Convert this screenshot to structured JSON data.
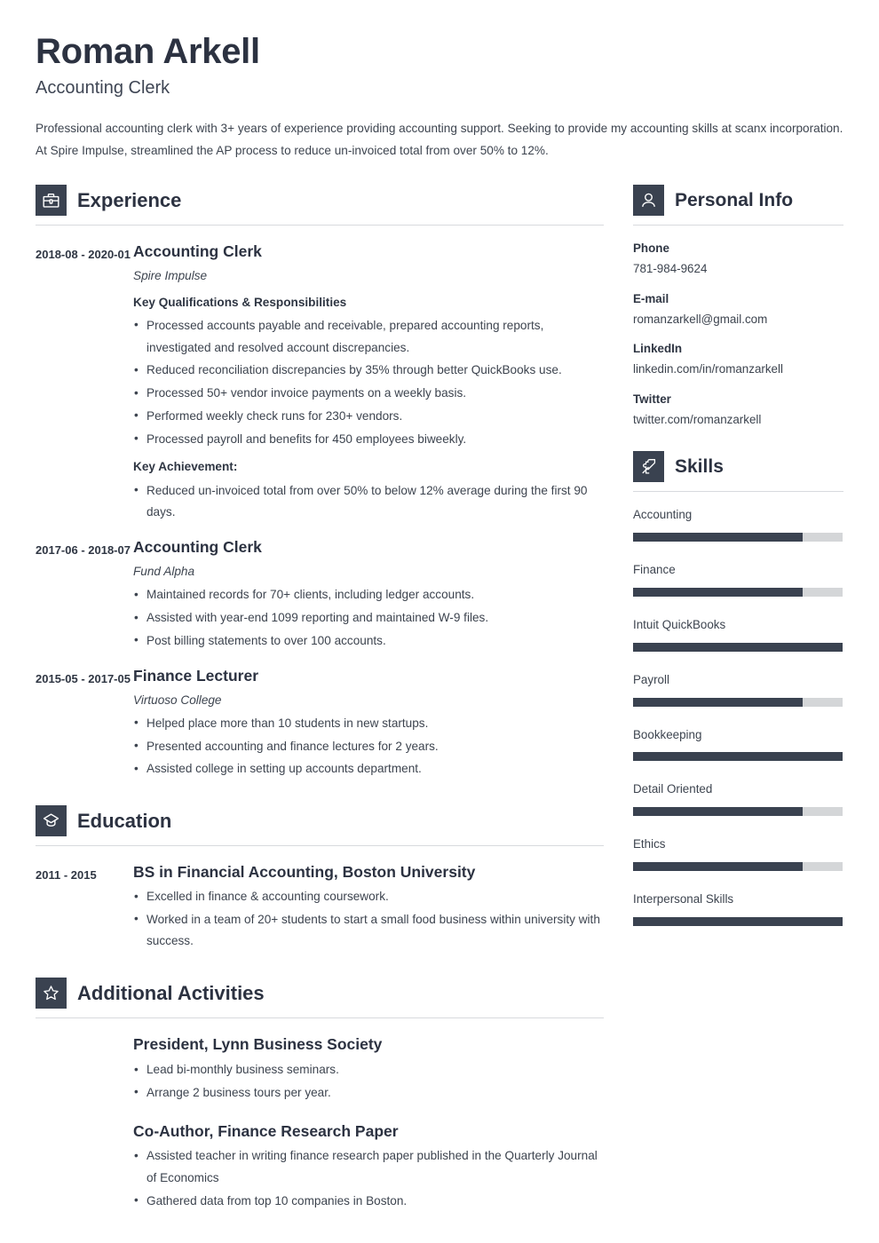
{
  "colors": {
    "accent_dark": "#3a4250",
    "text": "#3d444f",
    "heading": "#2c3241",
    "bar_track": "#d4d6d8",
    "divider": "#d8dade"
  },
  "header": {
    "name": "Roman Arkell",
    "job_title": "Accounting Clerk",
    "summary": "Professional accounting clerk with 3+ years of experience providing accounting support. Seeking to provide my accounting skills at scanx incorporation. At Spire Impulse, streamlined the AP process to reduce un-invoiced total from over 50% to 12%."
  },
  "experience": {
    "title": "Experience",
    "icon": "briefcase-icon",
    "entries": [
      {
        "dates": "2018-08 - 2020-01",
        "role": "Accounting Clerk",
        "org": "Spire Impulse",
        "sublabel": "Key Qualifications & Responsibilities",
        "bullets": [
          "Processed accounts payable and receivable, prepared accounting reports, investigated and resolved account discrepancies.",
          "Reduced reconciliation discrepancies by 35% through better QuickBooks use.",
          "Processed 50+ vendor invoice payments on a weekly basis.",
          "Performed weekly check runs for 230+ vendors.",
          "Processed payroll and benefits for 450 employees biweekly."
        ],
        "sublabel2": "Key Achievement:",
        "bullets2": [
          "Reduced un-invoiced total from over 50% to below 12% average during the first 90 days."
        ]
      },
      {
        "dates": "2017-06 - 2018-07",
        "role": "Accounting Clerk",
        "org": "Fund Alpha",
        "bullets": [
          "Maintained records for 70+ clients, including ledger accounts.",
          "Assisted with year-end 1099 reporting and maintained W-9 files.",
          "Post billing statements to over 100 accounts."
        ]
      },
      {
        "dates": "2015-05 - 2017-05",
        "role": "Finance Lecturer",
        "org": "Virtuoso College",
        "bullets": [
          "Helped place more than 10 students in new startups.",
          "Presented accounting and finance lectures for 2 years.",
          "Assisted college in setting up accounts department."
        ]
      }
    ]
  },
  "education": {
    "title": "Education",
    "icon": "graduation-cap-icon",
    "entries": [
      {
        "dates": "2011 - 2015",
        "degree": "BS in Financial Accounting, Boston University",
        "bullets": [
          "Excelled in finance & accounting coursework.",
          "Worked in a team of 20+ students to start a small food business within university with success."
        ]
      }
    ]
  },
  "activities": {
    "title": "Additional Activities",
    "icon": "star-icon",
    "items": [
      {
        "title": "President, Lynn Business Society",
        "bullets": [
          "Lead bi-monthly business seminars.",
          "Arrange 2 business tours per year."
        ]
      },
      {
        "title": "Co-Author, Finance Research Paper",
        "bullets": [
          "Assisted teacher in writing finance research paper published in the Quarterly Journal of Economics",
          "Gathered data from top 10 companies in Boston."
        ]
      }
    ]
  },
  "personal_info": {
    "title": "Personal Info",
    "icon": "person-icon",
    "items": [
      {
        "label": "Phone",
        "value": "781-984-9624"
      },
      {
        "label": "E-mail",
        "value": "romanzarkell@gmail.com"
      },
      {
        "label": "LinkedIn",
        "value": "linkedin.com/in/romanzarkell"
      },
      {
        "label": "Twitter",
        "value": "twitter.com/romanzarkell"
      }
    ]
  },
  "skills": {
    "title": "Skills",
    "icon": "puzzle-piece-icon",
    "items": [
      {
        "name": "Accounting",
        "level": 81
      },
      {
        "name": "Finance",
        "level": 81
      },
      {
        "name": "Intuit QuickBooks",
        "level": 100
      },
      {
        "name": "Payroll",
        "level": 81
      },
      {
        "name": "Bookkeeping",
        "level": 100
      },
      {
        "name": "Detail Oriented",
        "level": 81
      },
      {
        "name": "Ethics",
        "level": 81
      },
      {
        "name": "Interpersonal Skills",
        "level": 100
      }
    ]
  }
}
